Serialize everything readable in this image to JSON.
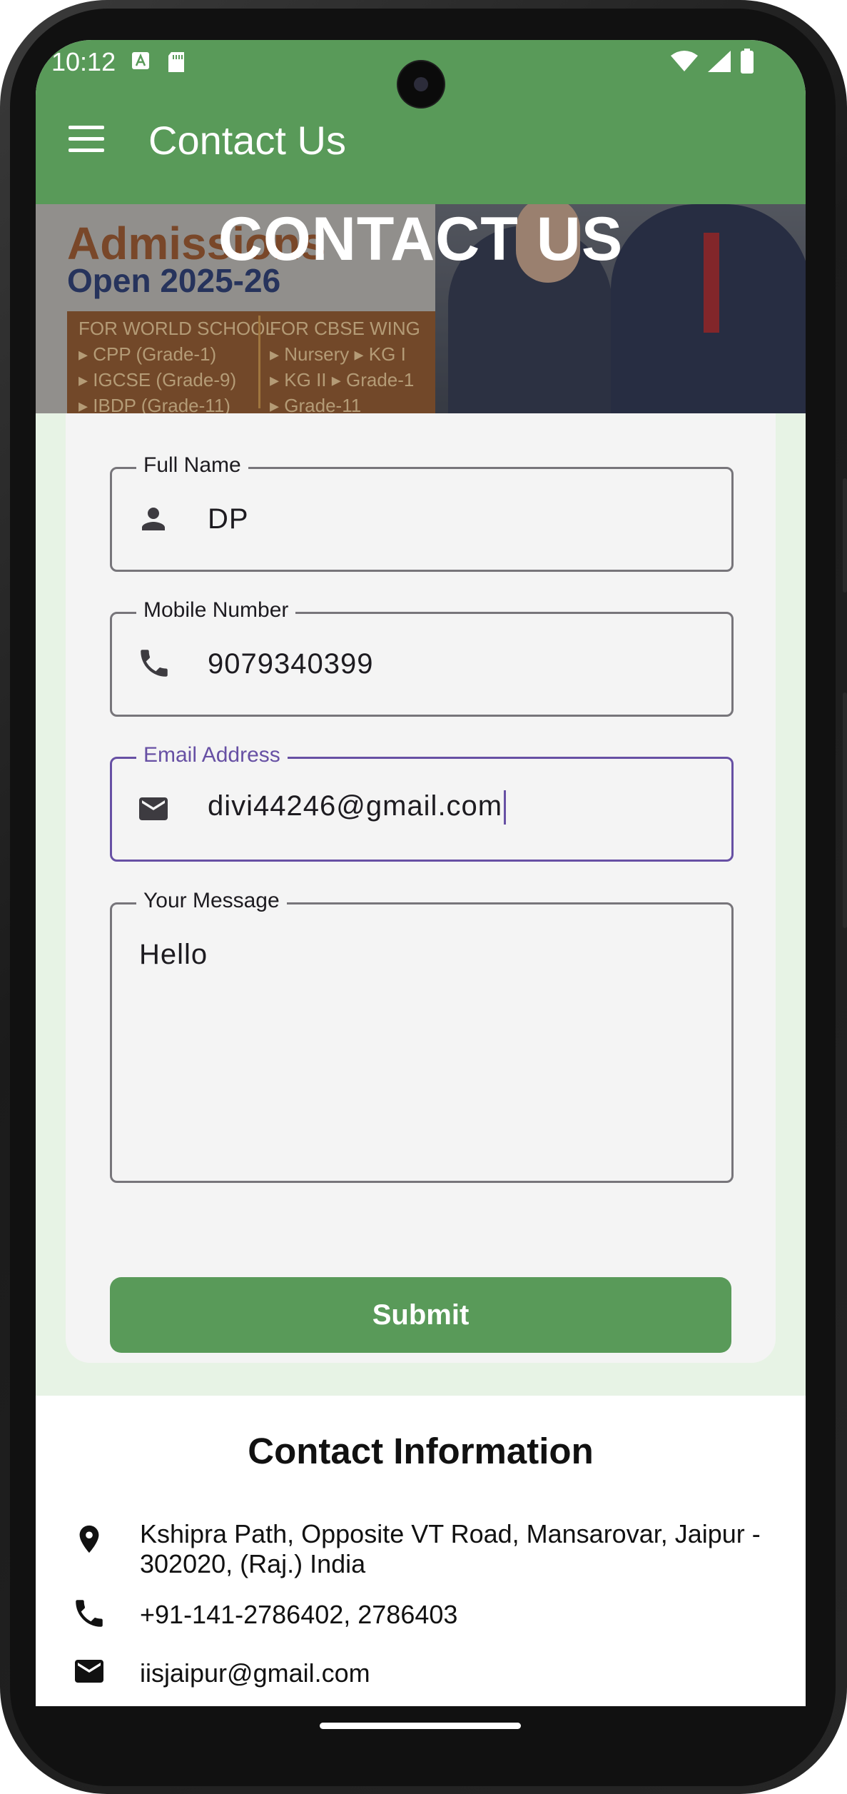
{
  "status_bar": {
    "time": "10:12"
  },
  "app_bar": {
    "title": "Contact Us"
  },
  "banner": {
    "heading": "CONTACT US",
    "admissions_line1": "Admissions",
    "admissions_line2": "Open 2025-26",
    "world_school": {
      "title": "FOR WORLD SCHOOL",
      "items": [
        "▸ CPP (Grade-1)",
        "▸ IGCSE (Grade-9)",
        "▸ IBDP (Grade-11)"
      ]
    },
    "cbse_wing": {
      "title": "FOR CBSE WING",
      "items": [
        "▸ Nursery  ▸ KG I",
        "▸ KG II  ▸ Grade-1",
        "▸ Grade-11"
      ]
    }
  },
  "form": {
    "full_name": {
      "label": "Full Name",
      "value": "DP"
    },
    "mobile": {
      "label": "Mobile Number",
      "value": "9079340399"
    },
    "email": {
      "label": "Email Address",
      "value": "divi44246@gmail.com"
    },
    "message": {
      "label": "Your Message",
      "value": "Hello"
    },
    "submit_label": "Submit"
  },
  "contact_info": {
    "title": "Contact Information",
    "address": "Kshipra Path, Opposite VT Road, Mansarovar, Jaipur - 302020, (Raj.) India",
    "phone": "+91-141-2786402, 2786403",
    "email": "iisjaipur@gmail.com"
  },
  "colors": {
    "primary": "#599a59",
    "form_bg": "#e7f3e5",
    "focus": "#6750a4"
  }
}
